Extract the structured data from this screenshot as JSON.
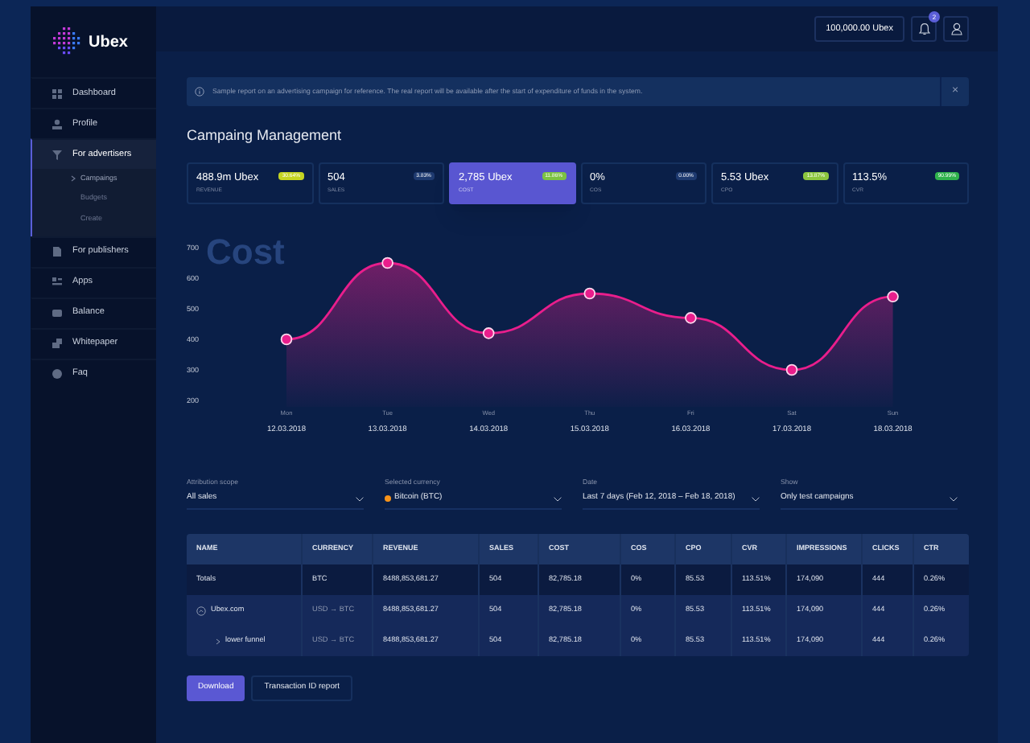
{
  "logo": {
    "text": "Ubex"
  },
  "sidebar": {
    "items": [
      {
        "label": "Dashboard",
        "selected": false
      },
      {
        "label": "Profile",
        "selected": false
      },
      {
        "label": "For advertisers",
        "selected": true,
        "expanded": true,
        "children": [
          {
            "label": "Campaings",
            "selected": true
          },
          {
            "label": "Budgets",
            "selected": false
          },
          {
            "label": "Create",
            "selected": false
          }
        ]
      },
      {
        "label": "For publishers",
        "selected": false
      },
      {
        "label": "Apps",
        "selected": false
      },
      {
        "label": "Balance",
        "selected": false
      },
      {
        "label": "Whitepaper",
        "selected": false
      },
      {
        "label": "Faq",
        "selected": false
      }
    ]
  },
  "header": {
    "balance": "100,000.00 Ubex",
    "notifications": "2"
  },
  "banner": {
    "text": "Sample report on an advertising campaign for reference. The real report will be available after the start of expenditure of funds in the system.",
    "close": "×"
  },
  "title": "Campaing Management",
  "cards": [
    {
      "value": "488.9m Ubex",
      "label": "REVENUE",
      "badge": "30.64%",
      "color": "#c4d422",
      "selected": false
    },
    {
      "value": "504",
      "label": "SALES",
      "badge": "3.83%",
      "color": "#1e3a70",
      "selected": false
    },
    {
      "value": "2,785 Ubex",
      "label": "COST",
      "badge": "11.86%",
      "color": "#7cc242",
      "selected": true
    },
    {
      "value": "0%",
      "label": "COS",
      "badge": "0.00%",
      "color": "#1e3a70",
      "selected": false
    },
    {
      "value": "5.53 Ubex",
      "label": "CPO",
      "badge": "13.87%",
      "color": "#8cc63f",
      "selected": false
    },
    {
      "value": "113.5%",
      "label": "CVR",
      "badge": "90.99%",
      "color": "#2fb24c",
      "selected": false
    }
  ],
  "chart": {
    "dates": [
      "12.03.2018",
      "13.03.2018",
      "14.03.2018",
      "15.03.2018",
      "16.03.2018",
      "17.03.2018",
      "18.03.2018"
    ],
    "chart_data": {
      "type": "area",
      "title": "Cost",
      "categories": [
        "Mon",
        "Tue",
        "Wed",
        "Thu",
        "Fri",
        "Sat",
        "Sun"
      ],
      "series": [
        {
          "color": "#e91e8c",
          "values": [
            400,
            650,
            420,
            550,
            470,
            300,
            540
          ]
        }
      ],
      "ylim": [
        200,
        700
      ],
      "yticks": [
        200,
        300,
        400,
        500,
        600,
        700
      ]
    }
  },
  "filters": [
    {
      "label": "Attribution scope",
      "value": "All sales",
      "kind": "plain"
    },
    {
      "label": "Selected currency",
      "value": "Bitcoin (BTC)",
      "kind": "coin"
    },
    {
      "label": "Date",
      "value": "Last 7 days (Feb 12, 2018 – Feb 18, 2018)",
      "kind": "plain"
    },
    {
      "label": "Show",
      "value": "Only test campaigns",
      "kind": "plain"
    }
  ],
  "table": {
    "columns": [
      "NAME",
      "CURRENCY",
      "REVENUE",
      "SALES",
      "COST",
      "COS",
      "CPO",
      "CVR",
      "IMPRESSIONS",
      "CLICKS",
      "CTR"
    ],
    "rows": [
      {
        "kind": "total",
        "cells": [
          "Totals",
          "BTC",
          "8488,853,681.27",
          "504",
          "82,785.18",
          "0%",
          "85.53",
          "113.51%",
          "174,090",
          "444",
          "0.26%"
        ]
      },
      {
        "kind": "group",
        "expanded": true,
        "cells": [
          "Ubex.com",
          "USD → BTC",
          "8488,853,681.27",
          "504",
          "82,785.18",
          "0%",
          "85.53",
          "113.51%",
          "174,090",
          "444",
          "0.26%"
        ]
      },
      {
        "kind": "child",
        "cells": [
          "lower funnel",
          "USD → BTC",
          "8488,853,681.27",
          "504",
          "82,785.18",
          "0%",
          "85.53",
          "113.51%",
          "174,090",
          "444",
          "0.26%"
        ]
      }
    ]
  },
  "buttons": [
    {
      "label": "Download",
      "kind": "primary"
    },
    {
      "label": "Transaction ID report",
      "kind": "outline"
    }
  ]
}
